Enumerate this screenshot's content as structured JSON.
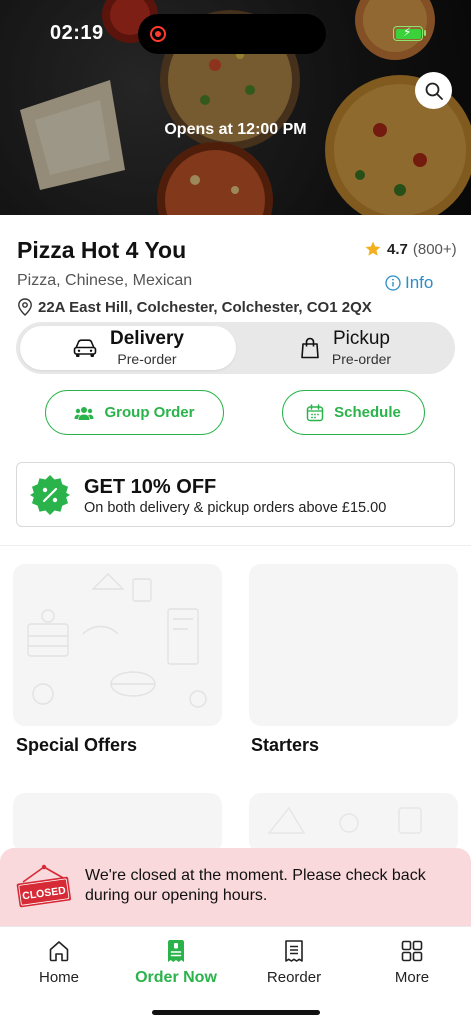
{
  "status_bar": {
    "time": "02:19"
  },
  "hero": {
    "opens_text": "Opens at 12:00 PM"
  },
  "restaurant": {
    "name": "Pizza Hot 4 You",
    "rating": "4.7",
    "rating_count": "(800+)",
    "cuisine": "Pizza, Chinese, Mexican",
    "info_label": "Info",
    "address": "22A East Hill, Colchester, Colchester, CO1 2QX"
  },
  "order_mode": {
    "delivery": {
      "label": "Delivery",
      "sub": "Pre-order",
      "selected": true
    },
    "pickup": {
      "label": "Pickup",
      "sub": "Pre-order",
      "selected": false
    }
  },
  "actions": {
    "group_order": "Group Order",
    "schedule": "Schedule"
  },
  "promo": {
    "headline": "GET 10% OFF",
    "description": "On both delivery & pickup orders above £15.00",
    "badge_color": "#2bb34b"
  },
  "categories": [
    {
      "label": "Special Offers"
    },
    {
      "label": "Starters"
    }
  ],
  "closed_banner": {
    "sign_text": "CLOSED",
    "message": "We're closed at the moment. Please check back during our opening hours."
  },
  "bottom_nav": {
    "items": [
      {
        "label": "Home",
        "icon": "home-icon"
      },
      {
        "label": "Order Now",
        "icon": "order-icon",
        "active": true
      },
      {
        "label": "Reorder",
        "icon": "receipt-icon"
      },
      {
        "label": "More",
        "icon": "grid-icon"
      }
    ]
  },
  "colors": {
    "accent": "#2bb34b",
    "link": "#2b8ec7",
    "closed_banner": "#f9d9db",
    "closed_sign": "#d62b36"
  }
}
